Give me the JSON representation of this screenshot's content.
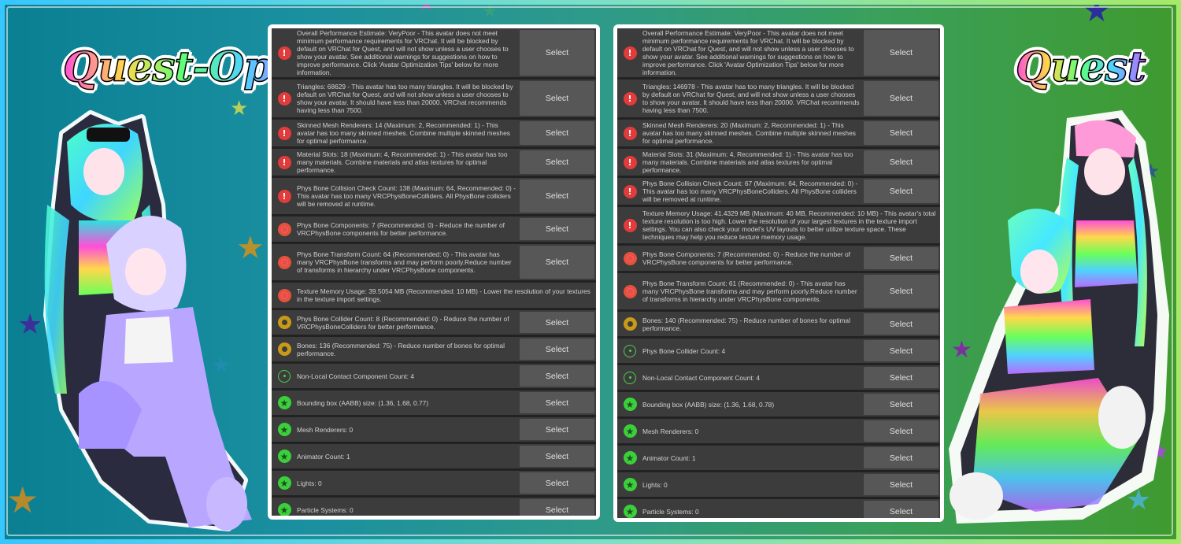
{
  "logos": {
    "left": "Quest-Opti",
    "right": "Quest"
  },
  "colors": {
    "error": "#e23b3b",
    "very_poor": "#e5523a",
    "medium": "#c99a17",
    "good": "#4cd04c",
    "excellent": "#3bcf3b"
  },
  "left_panel": {
    "rows": [
      {
        "icon": "error-icon",
        "text": "Overall Performance Estimate: VeryPoor - This avatar does not meet minimum performance requirements for VRChat. It will be blocked by default on VRChat for Quest, and will not show unless a user chooses to show your avatar. See additional warnings for suggestions on how to improve performance. Click 'Avatar Optimization Tips' below for more information.",
        "button": "Select"
      },
      {
        "icon": "error-icon",
        "text": "Triangles: 68629 - This avatar has too many triangles. It will be blocked by default on VRChat for Quest, and will not show unless a user chooses to show your avatar. It should have less than 20000. VRChat recommends having less than 7500.",
        "button": "Select"
      },
      {
        "icon": "error-icon",
        "text": "Skinned Mesh Renderers: 14 (Maximum: 2, Recommended: 1) - This avatar has too many skinned meshes. Combine multiple skinned meshes for optimal performance.",
        "button": "Select"
      },
      {
        "icon": "error-icon",
        "text": "Material Slots: 18 (Maximum: 4, Recommended: 1) - This avatar has too many materials. Combine materials and atlas textures for optimal performance.",
        "button": "Select"
      },
      {
        "icon": "error-icon",
        "text": "Phys Bone Collision Check Count: 138 (Maximum: 64, Recommended: 0) - This avatar has too many VRCPhysBoneColliders. All PhysBone colliders will be removed at runtime.",
        "button": "Select"
      },
      {
        "icon": "very-poor-icon",
        "text": "Phys Bone Components: 7 (Recommended: 0) - Reduce the number of VRCPhysBone components for better performance.",
        "button": "Select"
      },
      {
        "icon": "very-poor-icon",
        "text": "Phys Bone Transform Count: 64 (Recommended: 0) - This avatar has many VRCPhysBone transforms and may perform poorly.Reduce number of transforms in hierarchy under VRCPhysBone components.",
        "button": "Select"
      },
      {
        "icon": "very-poor-icon",
        "text": "Texture Memory Usage: 39.5054 MB (Recommended: 10 MB) - Lower the resolution of your textures in the texture import settings.",
        "button": ""
      },
      {
        "icon": "medium-icon",
        "text": "Phys Bone Collider Count: 8 (Recommended: 0) - Reduce the number of VRCPhysBoneColliders for better performance.",
        "button": "Select"
      },
      {
        "icon": "medium-icon",
        "text": "Bones: 136 (Recommended: 75) - Reduce number of bones for optimal performance.",
        "button": "Select"
      },
      {
        "icon": "good-icon",
        "text": "Non-Local Contact Component Count: 4",
        "button": "Select"
      },
      {
        "icon": "excellent-icon",
        "text": "Bounding box (AABB) size: (1.36, 1.68, 0.77)",
        "button": "Select"
      },
      {
        "icon": "excellent-icon",
        "text": "Mesh Renderers: 0",
        "button": "Select"
      },
      {
        "icon": "excellent-icon",
        "text": "Animator Count: 1",
        "button": "Select"
      },
      {
        "icon": "excellent-icon",
        "text": "Lights: 0",
        "button": "Select"
      },
      {
        "icon": "excellent-icon",
        "text": "Particle Systems: 0",
        "button": "Select"
      }
    ]
  },
  "right_panel": {
    "rows": [
      {
        "icon": "error-icon",
        "text": "Overall Performance Estimate: VeryPoor - This avatar does not meet minimum performance requirements for VRChat. It will be blocked by default on VRChat for Quest, and will not show unless a user chooses to show your avatar. See additional warnings for suggestions on how to improve performance. Click 'Avatar Optimization Tips' below for more information.",
        "button": "Select"
      },
      {
        "icon": "error-icon",
        "text": "Triangles: 146978 - This avatar has too many triangles. It will be blocked by default on VRChat for Quest, and will not show unless a user chooses to show your avatar. It should have less than 20000. VRChat recommends having less than 7500.",
        "button": "Select"
      },
      {
        "icon": "error-icon",
        "text": "Skinned Mesh Renderers: 20 (Maximum: 2, Recommended: 1) - This avatar has too many skinned meshes. Combine multiple skinned meshes for optimal performance.",
        "button": "Select"
      },
      {
        "icon": "error-icon",
        "text": "Material Slots: 31 (Maximum: 4, Recommended: 1) - This avatar has too many materials. Combine materials and atlas textures for optimal performance.",
        "button": "Select"
      },
      {
        "icon": "error-icon",
        "text": "Phys Bone Collision Check Count: 67 (Maximum: 64, Recommended: 0) - This avatar has too many VRCPhysBoneColliders. All PhysBone colliders will be removed at runtime.",
        "button": "Select"
      },
      {
        "icon": "error-icon",
        "text": "Texture Memory Usage: 41.4329 MB (Maximum: 40 MB, Recommended: 10 MB) - This avatar's total texture resolution is too high. Lower the resolution of your largest textures in the texture import settings. You can also check your model's UV layouts to better utilize texture space. These techniques may help you reduce texture memory usage.",
        "button": ""
      },
      {
        "icon": "very-poor-icon",
        "text": "Phys Bone Components: 7 (Recommended: 0) - Reduce the number of VRCPhysBone components for better performance.",
        "button": "Select"
      },
      {
        "icon": "very-poor-icon",
        "text": "Phys Bone Transform Count: 61 (Recommended: 0) - This avatar has many VRCPhysBone transforms and may perform poorly.Reduce number of transforms in hierarchy under VRCPhysBone components.",
        "button": "Select"
      },
      {
        "icon": "medium-icon",
        "text": "Bones: 140 (Recommended: 75) - Reduce number of bones for optimal performance.",
        "button": "Select"
      },
      {
        "icon": "good-icon",
        "text": "Phys Bone Collider Count: 4",
        "button": "Select"
      },
      {
        "icon": "good-icon",
        "text": "Non-Local Contact Component Count: 4",
        "button": "Select"
      },
      {
        "icon": "excellent-icon",
        "text": "Bounding box (AABB) size: (1.36, 1.68, 0.78)",
        "button": "Select"
      },
      {
        "icon": "excellent-icon",
        "text": "Mesh Renderers: 0",
        "button": "Select"
      },
      {
        "icon": "excellent-icon",
        "text": "Animator Count: 1",
        "button": "Select"
      },
      {
        "icon": "excellent-icon",
        "text": "Lights: 0",
        "button": "Select"
      },
      {
        "icon": "excellent-icon",
        "text": "Particle Systems: 0",
        "button": "Select"
      }
    ]
  }
}
